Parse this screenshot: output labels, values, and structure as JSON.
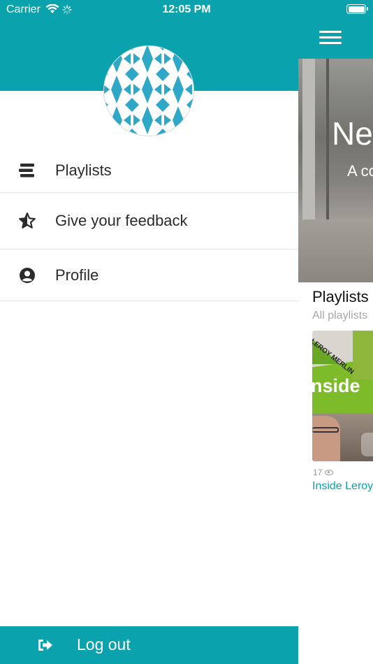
{
  "status_bar": {
    "carrier": "Carrier",
    "time": "12:05 PM",
    "icons": [
      "wifi-icon",
      "spinner-icon",
      "battery-icon"
    ]
  },
  "background_screen": {
    "menu_icon": "hamburger-menu-icon",
    "hero": {
      "title": "Nev",
      "subtitle": "A co"
    },
    "section": {
      "title": "Playlists",
      "subtitle": "All playlists"
    },
    "card": {
      "brand_text": "LEROY MERLIN",
      "thumbnail_text": "nside",
      "views": "17",
      "title": "Inside Leroy"
    }
  },
  "drawer": {
    "avatar": "geometric-avatar",
    "items": [
      {
        "label": "Playlists",
        "icon": "list-icon"
      },
      {
        "label": "Give your feedback",
        "icon": "star-half-icon"
      },
      {
        "label": "Profile",
        "icon": "user-circle-icon"
      }
    ],
    "logout": {
      "label": "Log out",
      "icon": "sign-out-icon"
    }
  },
  "colors": {
    "primary": "#0aa3ad",
    "avatar_tile": "#2fa7c7",
    "text": "#2b2b2b",
    "muted": "#a7a7a7"
  }
}
